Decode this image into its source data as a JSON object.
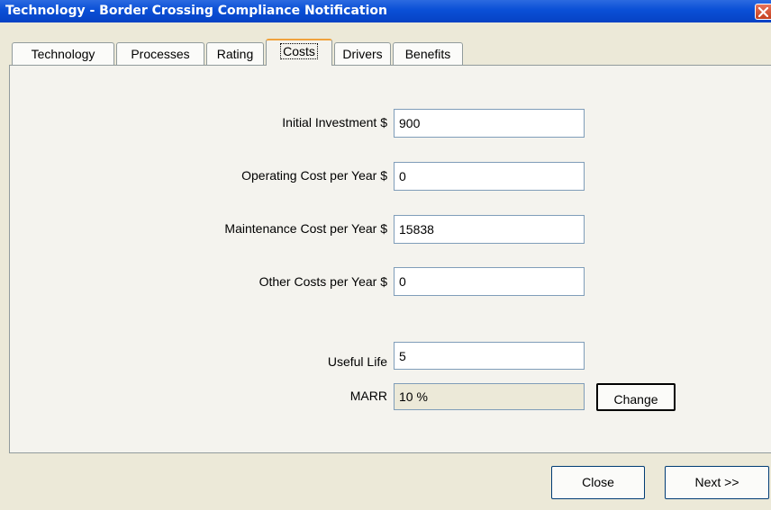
{
  "window": {
    "title": "Technology - Border Crossing Compliance Notification"
  },
  "tabs": [
    {
      "label": "Technology"
    },
    {
      "label": "Processes"
    },
    {
      "label": "Rating"
    },
    {
      "label": "Costs"
    },
    {
      "label": "Drivers"
    },
    {
      "label": "Benefits"
    }
  ],
  "active_tab": "Costs",
  "form": {
    "initial_investment": {
      "label": "Initial Investment $",
      "value": "900"
    },
    "operating_cost": {
      "label": "Operating Cost per Year $",
      "value": "0"
    },
    "maintenance_cost": {
      "label": "Maintenance Cost per Year $",
      "value": "15838"
    },
    "other_costs": {
      "label": "Other Costs per Year $",
      "value": "0"
    },
    "useful_life": {
      "label": "Useful Life",
      "value": "5"
    },
    "marr": {
      "label": "MARR",
      "value": "10 %",
      "change_label": "Change"
    }
  },
  "footer": {
    "close_label": "Close",
    "next_label": "Next >>"
  },
  "colors": {
    "title_bar": "#0a4fd6",
    "active_tab_accent": "#f0a23c",
    "dialog_bg": "#ece9d8"
  }
}
